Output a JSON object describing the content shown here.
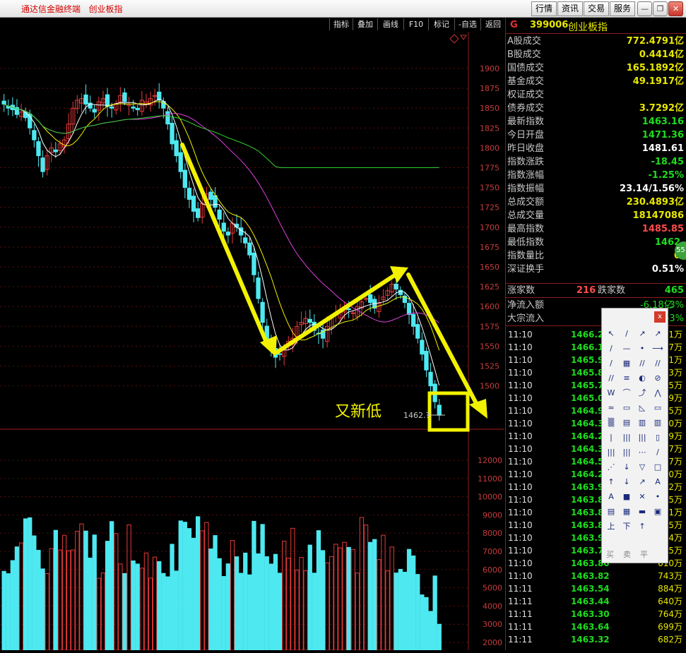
{
  "app": {
    "title": "通达信金融终端   创业板指",
    "menu": [
      "行情",
      "资讯",
      "交易",
      "服务"
    ]
  },
  "toolbar": {
    "buttons": [
      "指标",
      "叠加",
      "画线",
      "F10",
      "标记",
      "-自选",
      "返回"
    ]
  },
  "chart": {
    "price_axis": [
      "1900",
      "1875",
      "1850",
      "1825",
      "1800",
      "1775",
      "1750",
      "1725",
      "1700",
      "1675",
      "1650",
      "1625",
      "1600",
      "1575",
      "1550",
      "1525",
      "1500"
    ],
    "volume_axis": [
      "12000",
      "11000",
      "10000",
      "9000",
      "8000",
      "7000",
      "6000",
      "5000",
      "4000",
      "3000",
      "2000"
    ],
    "annotation": "又新低",
    "last_price_label": "1462.7"
  },
  "quote": {
    "code_prefix": "G",
    "code": "399006",
    "name": "创业板指",
    "rows": [
      {
        "label": "A股成交",
        "value": "772.4791亿",
        "color": "#e8e800"
      },
      {
        "label": "B股成交",
        "value": "0.4414亿",
        "color": "#e8e800"
      },
      {
        "label": "国债成交",
        "value": "165.1892亿",
        "color": "#e8e800"
      },
      {
        "label": "基金成交",
        "value": "49.1917亿",
        "color": "#e8e800"
      },
      {
        "label": "权证成交",
        "value": "",
        "color": "#e8e800"
      },
      {
        "label": "债券成交",
        "value": "3.7292亿",
        "color": "#e8e800"
      },
      {
        "label": "最新指数",
        "value": "1463.16",
        "color": "#1edc1e"
      },
      {
        "label": "今日开盘",
        "value": "1471.36",
        "color": "#1edc1e"
      },
      {
        "label": "昨日收盘",
        "value": "1481.61",
        "color": "#ffffff"
      },
      {
        "label": "指数涨跌",
        "value": "-18.45",
        "color": "#1edc1e"
      },
      {
        "label": "指数涨幅",
        "value": "-1.25%",
        "color": "#1edc1e"
      },
      {
        "label": "指数振幅",
        "value": "23.14/1.56%",
        "color": "#ffffff"
      },
      {
        "label": "总成交额",
        "value": "230.4893亿",
        "color": "#e8e800"
      },
      {
        "label": "总成交量",
        "value": "18147086",
        "color": "#e8e800"
      },
      {
        "label": "最高指数",
        "value": "1485.85",
        "color": "#ff4a4a"
      },
      {
        "label": "最低指数",
        "value": "1462.",
        "color": "#1edc1e"
      },
      {
        "label": "指数量比",
        "value": "0.",
        "color": "#e8e800"
      },
      {
        "label": "深证换手",
        "value": "0.51%",
        "color": "#ffffff"
      }
    ],
    "up_label": "涨家数",
    "up_count": "216",
    "down_label": "跌家数",
    "down_count": "465",
    "flow_rows": [
      {
        "label": "净流入额",
        "value": "-6.18亿",
        "pct": "-3%"
      },
      {
        "label": "大宗流入",
        "value": "",
        "pct": "-3%"
      }
    ],
    "badge": "55"
  },
  "ticks": [
    {
      "time": "11:10",
      "price": "1466.2",
      "vol": "1万"
    },
    {
      "time": "11:10",
      "price": "1466.1",
      "vol": "7万"
    },
    {
      "time": "11:10",
      "price": "1465.9",
      "vol": "1万"
    },
    {
      "time": "11:10",
      "price": "1465.8",
      "vol": "3万"
    },
    {
      "time": "11:10",
      "price": "1465.7",
      "vol": "5万"
    },
    {
      "time": "11:10",
      "price": "1465.0",
      "vol": "9万"
    },
    {
      "time": "11:10",
      "price": "1464.9",
      "vol": "5万"
    },
    {
      "time": "11:10",
      "price": "1464.3",
      "vol": "0万"
    },
    {
      "time": "11:10",
      "price": "1464.2",
      "vol": "9万"
    },
    {
      "time": "11:10",
      "price": "1464.3",
      "vol": "7万"
    },
    {
      "time": "11:10",
      "price": "1464.5",
      "vol": "7万"
    },
    {
      "time": "11:10",
      "price": "1464.2",
      "vol": "0万"
    },
    {
      "time": "11:10",
      "price": "1463.9",
      "vol": "2万"
    },
    {
      "time": "11:10",
      "price": "1463.8",
      "vol": "5万"
    },
    {
      "time": "11:10",
      "price": "1463.8",
      "vol": "1万"
    },
    {
      "time": "11:10",
      "price": "1463.8",
      "vol": "5万"
    },
    {
      "time": "11:10",
      "price": "1463.9",
      "vol": "4万"
    },
    {
      "time": "11:10",
      "price": "1463.7",
      "vol": "5万"
    },
    {
      "time": "11:10",
      "price": "1463.80",
      "vol": "610万"
    },
    {
      "time": "11:10",
      "price": "1463.82",
      "vol": "743万"
    },
    {
      "time": "11:11",
      "price": "1463.54",
      "vol": "884万"
    },
    {
      "time": "11:11",
      "price": "1463.44",
      "vol": "640万"
    },
    {
      "time": "11:11",
      "price": "1463.30",
      "vol": "764万"
    },
    {
      "time": "11:11",
      "price": "1463.64",
      "vol": "699万"
    },
    {
      "time": "11:11",
      "price": "1463.32",
      "vol": "682万"
    }
  ],
  "draw_palette": {
    "close": "x",
    "buy": "买",
    "sell": "卖",
    "flat": "平"
  }
}
